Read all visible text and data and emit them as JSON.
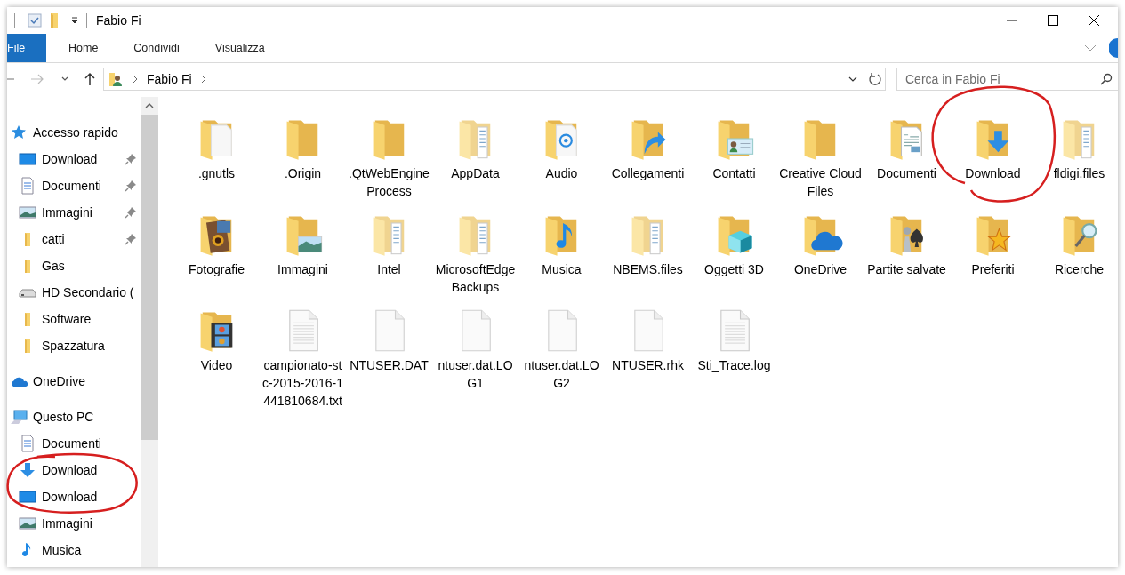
{
  "window": {
    "title": "Fabio Fi"
  },
  "ribbon": {
    "tabs": [
      {
        "label": "File",
        "kind": "menu",
        "selected": false
      },
      {
        "label": "Home",
        "kind": "tab",
        "selected": false
      },
      {
        "label": "Condividi",
        "kind": "tab",
        "selected": false
      },
      {
        "label": "Visualizza",
        "kind": "tab",
        "selected": false
      }
    ]
  },
  "address_bar": {
    "path": [
      "Fabio Fi"
    ]
  },
  "search": {
    "placeholder": "Cerca in Fabio Fi"
  },
  "navigation_pane": [
    {
      "label": "Accesso rapido",
      "kind": "quick",
      "children": [
        {
          "label": "Download",
          "kind": "desktop",
          "pinned": true
        },
        {
          "label": "Documenti",
          "kind": "document",
          "pinned": true
        },
        {
          "label": "Immagini",
          "kind": "pictures",
          "pinned": true
        },
        {
          "label": "catti",
          "kind": "folder",
          "pinned": true
        },
        {
          "label": "Gas",
          "kind": "folder",
          "pinned": false
        },
        {
          "label": "HD Secondario (",
          "kind": "drive",
          "pinned": false
        },
        {
          "label": "Software",
          "kind": "folder",
          "pinned": false
        },
        {
          "label": "Spazzatura",
          "kind": "folder",
          "pinned": false
        }
      ]
    },
    {
      "label": "OneDrive",
      "kind": "cloud"
    },
    {
      "label": "Questo PC",
      "kind": "pc",
      "children": [
        {
          "label": "Documenti",
          "kind": "document",
          "pinned": false
        },
        {
          "label": "Download",
          "kind": "download",
          "pinned": false
        },
        {
          "label": "Download",
          "kind": "desktop",
          "pinned": false
        },
        {
          "label": "Immagini",
          "kind": "pictures",
          "pinned": false
        },
        {
          "label": "Musica",
          "kind": "music",
          "pinned": false
        }
      ]
    }
  ],
  "items": [
    {
      "name": ".gnutls",
      "kind": "paperfolder"
    },
    {
      "name": ".Origin",
      "kind": "folder"
    },
    {
      "name": ".QtWebEngineProcess",
      "kind": "folder"
    },
    {
      "name": "AppData",
      "kind": "filesfolder"
    },
    {
      "name": "Audio",
      "kind": "audio"
    },
    {
      "name": "Collegamenti",
      "kind": "links"
    },
    {
      "name": "Contatti",
      "kind": "contacts"
    },
    {
      "name": "Creative Cloud Files",
      "kind": "folder"
    },
    {
      "name": "Documenti",
      "kind": "documents"
    },
    {
      "name": "Download",
      "kind": "downloads"
    },
    {
      "name": "fldigi.files",
      "kind": "filesfolder"
    },
    {
      "name": "Fotografie",
      "kind": "photos"
    },
    {
      "name": "Immagini",
      "kind": "pictures"
    },
    {
      "name": "Intel",
      "kind": "filesfolder"
    },
    {
      "name": "MicrosoftEdgeBackups",
      "kind": "filesfolder"
    },
    {
      "name": "Musica",
      "kind": "music"
    },
    {
      "name": "NBEMS.files",
      "kind": "filesfolder"
    },
    {
      "name": "Oggetti 3D",
      "kind": "objects"
    },
    {
      "name": "OneDrive",
      "kind": "cloud"
    },
    {
      "name": "Partite salvate",
      "kind": "games"
    },
    {
      "name": "Preferiti",
      "kind": "favorites"
    },
    {
      "name": "Ricerche",
      "kind": "searches"
    },
    {
      "name": "Video",
      "kind": "videos"
    },
    {
      "name": "campionato-stc-2015-2016-1441810684.txt",
      "kind": "textfile"
    },
    {
      "name": "NTUSER.DAT",
      "kind": "blankfile"
    },
    {
      "name": "ntuser.dat.LOG1",
      "kind": "blankfile"
    },
    {
      "name": "ntuser.dat.LOG2",
      "kind": "blankfile"
    },
    {
      "name": "NTUSER.rhk",
      "kind": "blankfile"
    },
    {
      "name": "Sti_Trace.log",
      "kind": "textfile"
    }
  ]
}
